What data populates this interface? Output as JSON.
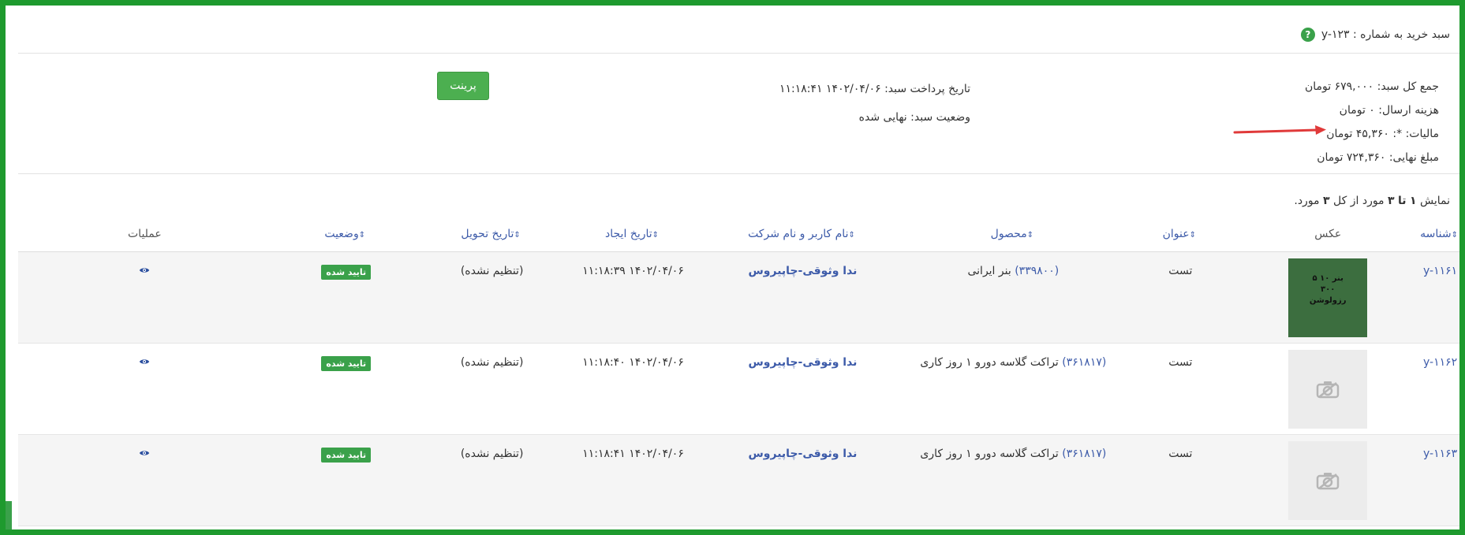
{
  "header": {
    "title": "سبد خرید به شماره : y-۱۲۳",
    "help_icon": "question-circle-icon"
  },
  "summary": {
    "total": "جمع کل سبد: ۶۷۹,۰۰۰ تومان",
    "shipping": "هزینه ارسال: ۰ تومان",
    "tax": "مالیات: *: ۴۵,۳۶۰ تومان",
    "final": "مبلغ نهایی: ۷۲۴,۳۶۰ تومان",
    "payment_date": "تاریخ پرداخت سبد: ۱۴۰۲/۰۴/۰۶ ۱۱:۱۸:۴۱",
    "status": "وضعیت سبد: نهایی شده",
    "print_label": "پرینت"
  },
  "results": {
    "prefix": "نمایش",
    "from": "۱",
    "to_word": "تا",
    "to": "۳",
    "mid": "مورد از کل",
    "total": "۳",
    "suffix": "مورد."
  },
  "table": {
    "headers": {
      "id": "شناسه",
      "photo": "عکس",
      "title": "عنوان",
      "product": "محصول",
      "user": "نام کاربر و نام شرکت",
      "created": "تاریخ ایجاد",
      "delivery": "تاریخ تحویل",
      "status": "وضعیت",
      "actions": "عملیات"
    },
    "rows": [
      {
        "id": "y-۱۱۶۱",
        "photo_text": "بنر ۱۰ ۵ ۳۰۰ رزولوشن",
        "title": "تست",
        "product_code": "(۳۳۹۸۰۰)",
        "product_name": "بنر ایرانی",
        "user": "ندا وثوقی-چاپیروس",
        "created": "۱۴۰۲/۰۴/۰۶ ۱۱:۱۸:۳۹",
        "delivery": "(تنظیم نشده)",
        "status": "تایید شده"
      },
      {
        "id": "y-۱۱۶۲",
        "photo_text": "",
        "title": "تست",
        "product_code": "(۳۶۱۸۱۷)",
        "product_name": "تراکت گلاسه دورو ۱ روز کاری",
        "user": "ندا وثوقی-چاپیروس",
        "created": "۱۴۰۲/۰۴/۰۶ ۱۱:۱۸:۴۰",
        "delivery": "(تنظیم نشده)",
        "status": "تایید شده"
      },
      {
        "id": "y-۱۱۶۳",
        "photo_text": "",
        "title": "تست",
        "product_code": "(۳۶۱۸۱۷)",
        "product_name": "تراکت گلاسه دورو ۱ روز کاری",
        "user": "ندا وثوقی-چاپیروس",
        "created": "۱۴۰۲/۰۴/۰۶ ۱۱:۱۸:۴۱",
        "delivery": "(تنظیم نشده)",
        "status": "تایید شده"
      }
    ]
  },
  "colors": {
    "border": "#1e9a2e",
    "accent": "#4caf50",
    "link": "#3d5ba9",
    "arrow": "#e03a3a"
  }
}
